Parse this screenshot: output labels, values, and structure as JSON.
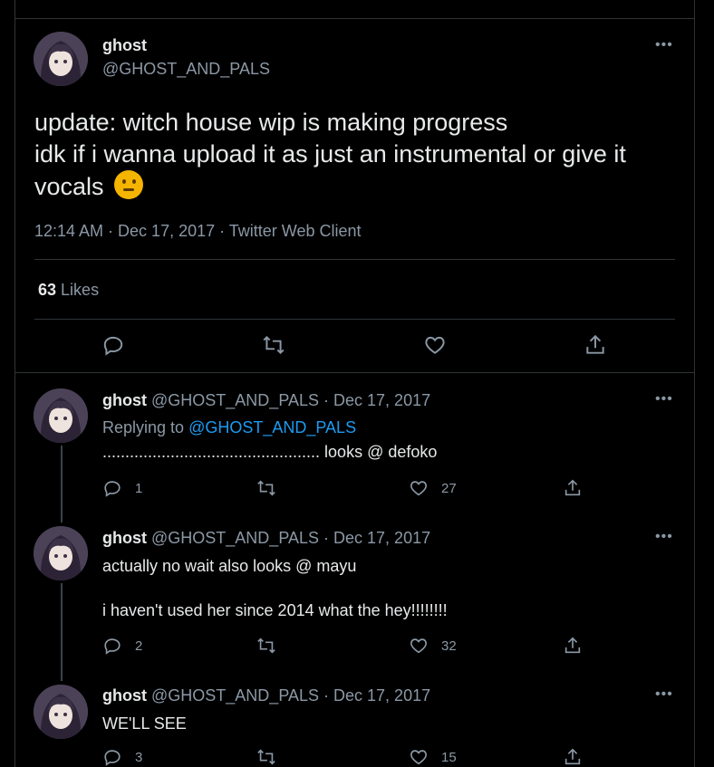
{
  "main_tweet": {
    "author_name": "ghost",
    "author_handle": "@GHOST_AND_PALS",
    "text_line1": "update: witch house wip is making progress",
    "text_line2": "idk if i wanna upload it as just an instrumental or give it",
    "text_line3": "vocals",
    "emoji": "thinking-face",
    "timestamp": "12:14 AM · Dec 17, 2017 · Twitter Web Client",
    "likes_count": "63",
    "likes_label": "Likes"
  },
  "replies": [
    {
      "author_name": "ghost",
      "author_handle": "@GHOST_AND_PALS",
      "date": "· Dec 17, 2017",
      "replying_prefix": "Replying to",
      "replying_handle": "@GHOST_AND_PALS",
      "text": "................................................ looks @ defoko",
      "reply_count": "1",
      "retweet_count": "",
      "like_count": "27"
    },
    {
      "author_name": "ghost",
      "author_handle": "@GHOST_AND_PALS",
      "date": "· Dec 17, 2017",
      "text": "actually no wait also looks @ mayu",
      "text2": "i haven't used her since 2014 what the hey!!!!!!!!",
      "reply_count": "2",
      "retweet_count": "",
      "like_count": "32"
    },
    {
      "author_name": "ghost",
      "author_handle": "@GHOST_AND_PALS",
      "date": "· Dec 17, 2017",
      "text": "WE'LL SEE",
      "reply_count": "3",
      "retweet_count": "",
      "like_count": "15"
    }
  ],
  "icons": {
    "more": "more-icon",
    "reply": "reply-icon",
    "retweet": "retweet-icon",
    "like": "like-icon",
    "share": "share-icon"
  },
  "colors": {
    "background": "#000000",
    "text": "#e7e9ea",
    "secondary": "#8b98a5",
    "link": "#1d9bf0",
    "divider": "#2f3336"
  }
}
